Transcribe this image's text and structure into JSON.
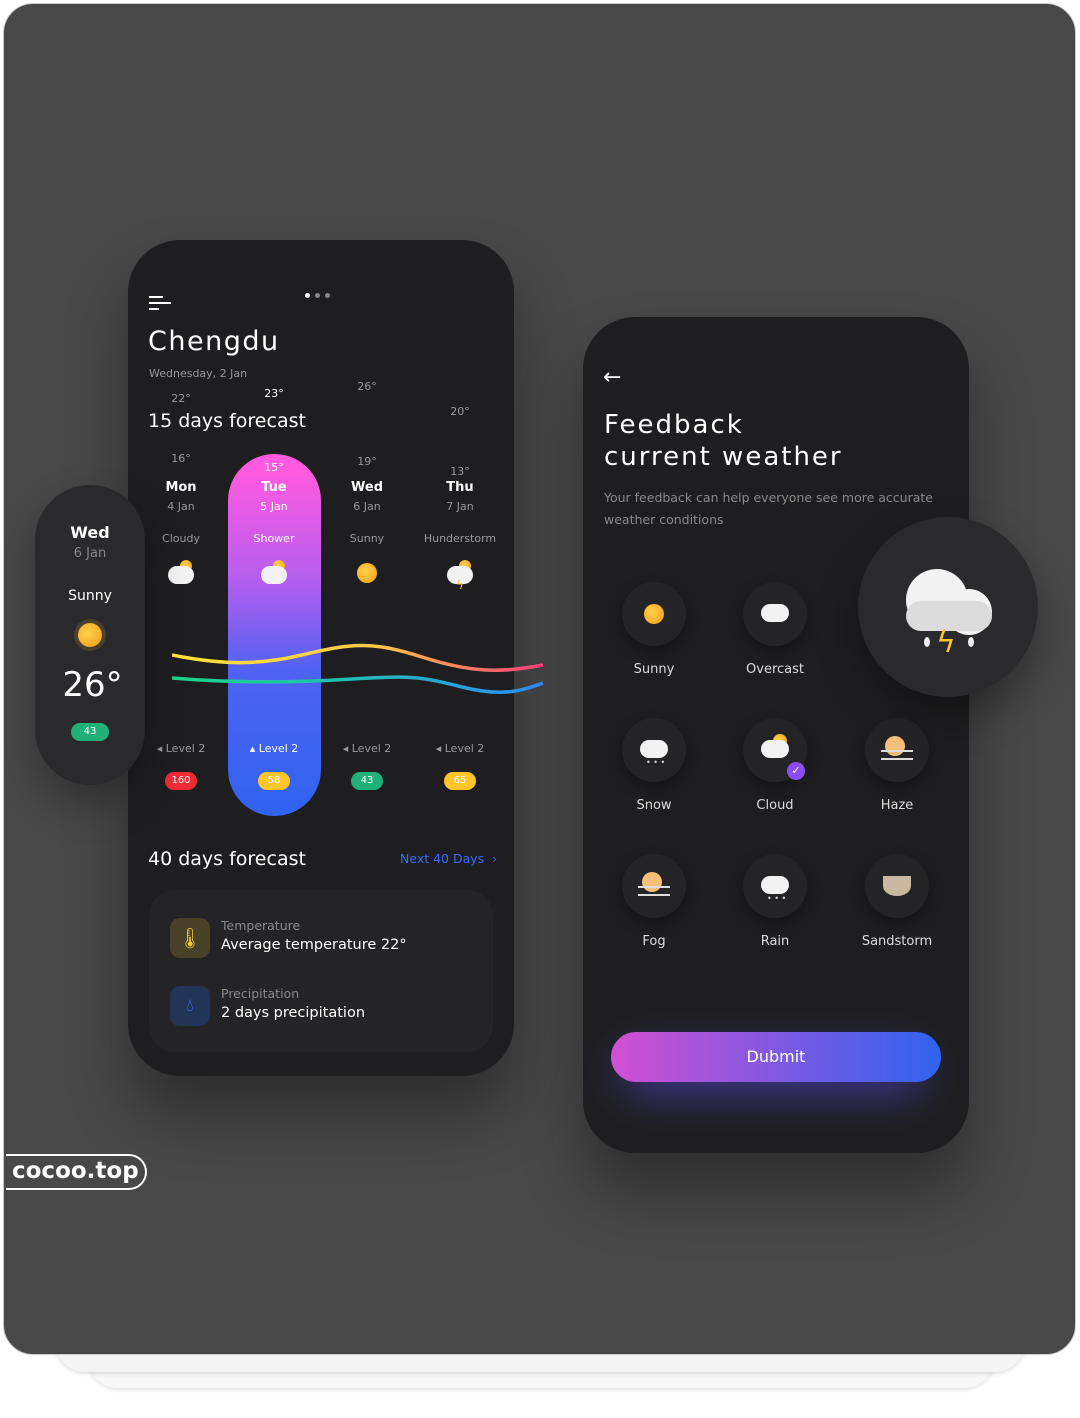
{
  "watermark": "cocoo.top",
  "left_phone": {
    "city": "Chengdu",
    "date": "Wednesday, 2 Jan",
    "forecast15_title": "15 days forecast",
    "days": [
      {
        "day": "Mon",
        "date": "4 Jan",
        "cond": "Cloudy",
        "high": "22°",
        "low": "16°",
        "wind": "Level 2",
        "aqi": "160",
        "aqi_color": "#ee2a35",
        "icon": "partly-cloudy-icon"
      },
      {
        "day": "Tue",
        "date": "5 Jan",
        "cond": "Shower",
        "high": "23°",
        "low": "15°",
        "wind": "Level 2",
        "aqi": "58",
        "aqi_color": "#ffc629",
        "icon": "shower-icon"
      },
      {
        "day": "Wed",
        "date": "6 Jan",
        "cond": "Sunny",
        "high": "26°",
        "low": "19°",
        "wind": "Level 2",
        "aqi": "43",
        "aqi_color": "#20b07a",
        "icon": "sun-icon"
      },
      {
        "day": "Thu",
        "date": "7 Jan",
        "cond": "Hunderstorm",
        "high": "20°",
        "low": "13°",
        "wind": "Level 2",
        "aqi": "65",
        "aqi_color": "#ffc629",
        "icon": "thunderstorm-icon"
      }
    ],
    "forecast40_title": "40 days forecast",
    "next_link": "Next 40 Days",
    "summary": [
      {
        "label": "Temperature",
        "value": "Average temperature 22°",
        "icon": "thermometer-icon"
      },
      {
        "label": "Precipitation",
        "value": "2 days precipitation",
        "icon": "water-drop-icon"
      }
    ]
  },
  "floating_day": {
    "day": "Wed",
    "date": "6 Jan",
    "cond": "Sunny",
    "temp": "26°",
    "aqi": "43"
  },
  "right_phone": {
    "title_line1": "Feedback",
    "title_line2": "current weather",
    "subtitle": "Your feedback can help everyone see more accurate weather conditions",
    "options": [
      "Sunny",
      "Overcast",
      "Snow",
      "Cloud",
      "Haze",
      "Fog",
      "Rain",
      "Sandstorm"
    ],
    "selected": "Cloud",
    "submit_label": "Dubmit"
  },
  "colors": {
    "accent_blue": "#2f63f0",
    "accent_pink": "#ff5ae0"
  }
}
